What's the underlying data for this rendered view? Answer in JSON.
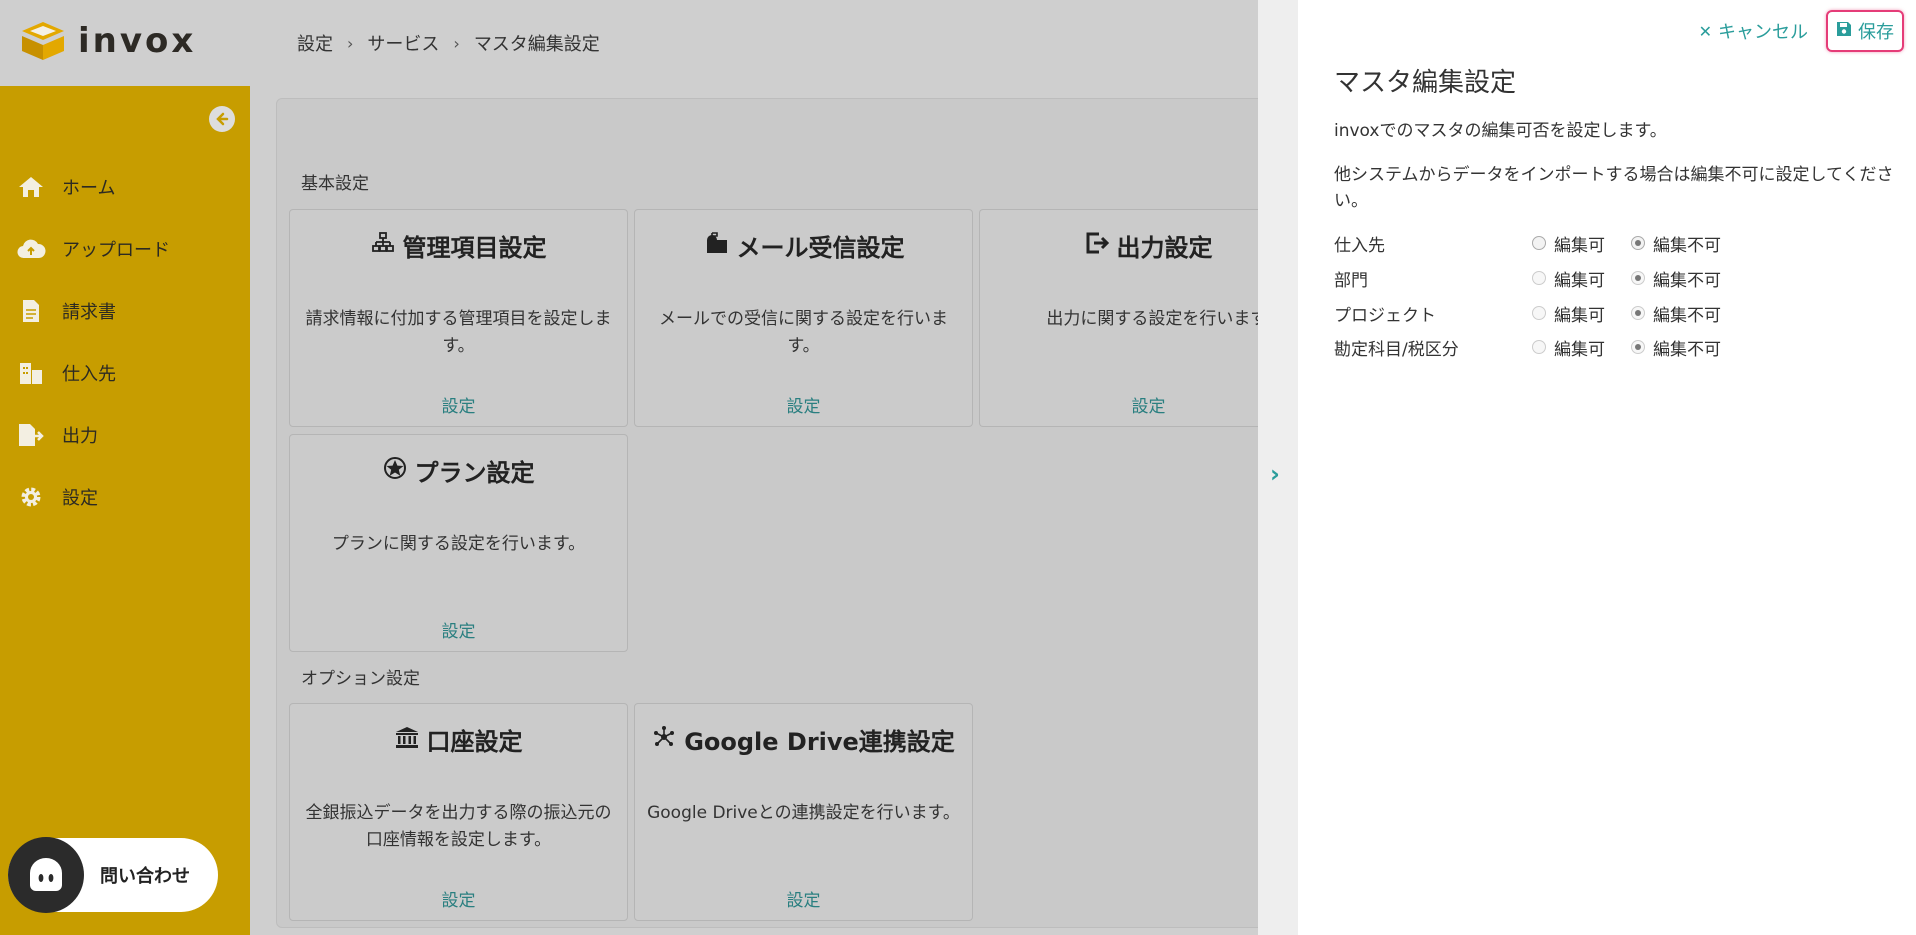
{
  "app": {
    "name": "invox"
  },
  "breadcrumb": [
    "設定",
    "サービス",
    "マスタ編集設定"
  ],
  "sidebar": {
    "items": [
      {
        "label": "ホーム",
        "icon": "home-icon"
      },
      {
        "label": "アップロード",
        "icon": "cloud-upload-icon"
      },
      {
        "label": "請求書",
        "icon": "document-icon"
      },
      {
        "label": "仕入先",
        "icon": "building-icon"
      },
      {
        "label": "出力",
        "icon": "export-file-icon"
      },
      {
        "label": "設定",
        "icon": "gear-icon"
      }
    ],
    "contact_label": "問い合わせ"
  },
  "main": {
    "section_basic": "基本設定",
    "section_option": "オプション設定",
    "cards": [
      {
        "title": "管理項目設定",
        "desc": "請求情報に付加する管理項目を設定します。",
        "link": "設定",
        "icon": "sitemap-icon"
      },
      {
        "title": "メール受信設定",
        "desc": "メールでの受信に関する設定を行います。",
        "link": "設定",
        "icon": "mailbox-icon"
      },
      {
        "title": "出力設定",
        "desc": "出力に関する設定を行います。",
        "link": "設定",
        "icon": "sign-out-icon"
      },
      {
        "title": "プラン設定",
        "desc": "プランに関する設定を行います。",
        "link": "設定",
        "icon": "star-badge-icon"
      },
      {
        "title": "口座設定",
        "desc": "全銀振込データを出力する際の振込元の口座情報を設定します。",
        "link": "設定",
        "icon": "bank-icon"
      },
      {
        "title": "Google Drive連携設定",
        "desc": "Google Driveとの連携設定を行います。",
        "link": "設定",
        "icon": "network-icon"
      }
    ]
  },
  "drawer": {
    "cancel_label": "キャンセル",
    "save_label": "保存",
    "title": "マスタ編集設定",
    "desc1": "invoxでのマスタの編集可否を設定します。",
    "desc2": "他システムからデータをインポートする場合は編集不可に設定してください。",
    "option_editable": "編集可",
    "option_not_editable": "編集不可",
    "rows": [
      {
        "label": "仕入先",
        "selected": "編集不可"
      },
      {
        "label": "部門",
        "selected": "編集不可"
      },
      {
        "label": "プロジェクト",
        "selected": "編集不可"
      },
      {
        "label": "勘定科目/税区分",
        "selected": "編集不可"
      }
    ]
  },
  "colors": {
    "sidebar": "#c79d00",
    "accent": "#2a9d9b",
    "save_highlight": "#e53c78"
  }
}
